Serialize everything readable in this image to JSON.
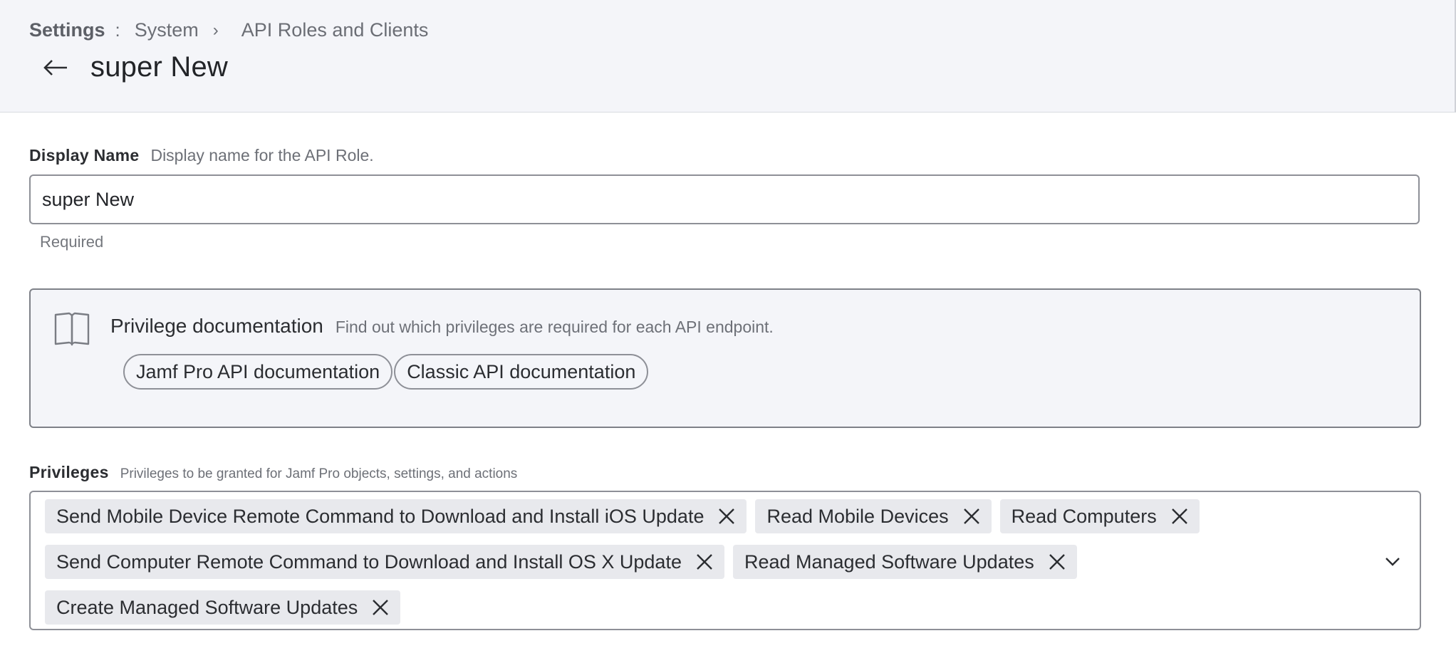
{
  "breadcrumb": {
    "root": "Settings",
    "root_sep": ":",
    "items": [
      "System",
      "API Roles and Clients"
    ],
    "sep": "›"
  },
  "header": {
    "title": "super New",
    "back_icon": "arrow-left-icon"
  },
  "display_name": {
    "label": "Display Name",
    "help": "Display name for the API Role.",
    "value": "super New",
    "required_text": "Required"
  },
  "privilege_docs": {
    "icon": "book-icon",
    "title": "Privilege documentation",
    "subtitle": "Find out which privileges are required for each API endpoint.",
    "links": [
      "Jamf Pro API documentation",
      "Classic API documentation"
    ]
  },
  "privileges": {
    "label": "Privileges",
    "help": "Privileges to be granted for Jamf Pro objects, settings, and actions",
    "selected": [
      "Send Mobile Device Remote Command to Download and Install iOS Update",
      "Read Mobile Devices",
      "Read Computers",
      "Send Computer Remote Command to Download and Install OS X Update",
      "Read Managed Software Updates",
      "Create Managed Software Updates"
    ]
  },
  "colors": {
    "header_bg": "#f4f5f9",
    "border": "#8e9097",
    "chip_bg": "#e8e9ed",
    "text": "#2b2d31"
  }
}
